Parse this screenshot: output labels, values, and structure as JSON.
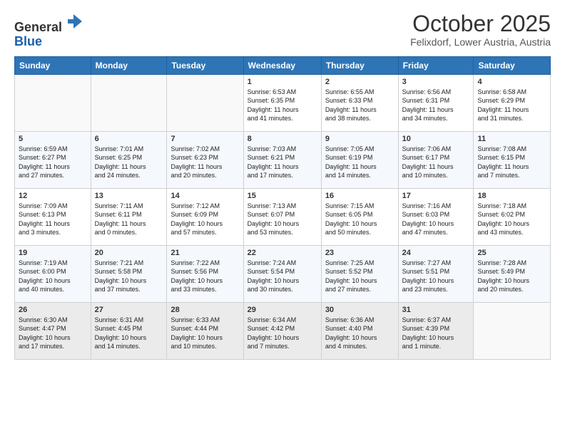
{
  "header": {
    "logo_line1": "General",
    "logo_line2": "Blue",
    "month": "October 2025",
    "location": "Felixdorf, Lower Austria, Austria"
  },
  "weekdays": [
    "Sunday",
    "Monday",
    "Tuesday",
    "Wednesday",
    "Thursday",
    "Friday",
    "Saturday"
  ],
  "weeks": [
    [
      {
        "day": "",
        "info": ""
      },
      {
        "day": "",
        "info": ""
      },
      {
        "day": "",
        "info": ""
      },
      {
        "day": "1",
        "info": "Sunrise: 6:53 AM\nSunset: 6:35 PM\nDaylight: 11 hours\nand 41 minutes."
      },
      {
        "day": "2",
        "info": "Sunrise: 6:55 AM\nSunset: 6:33 PM\nDaylight: 11 hours\nand 38 minutes."
      },
      {
        "day": "3",
        "info": "Sunrise: 6:56 AM\nSunset: 6:31 PM\nDaylight: 11 hours\nand 34 minutes."
      },
      {
        "day": "4",
        "info": "Sunrise: 6:58 AM\nSunset: 6:29 PM\nDaylight: 11 hours\nand 31 minutes."
      }
    ],
    [
      {
        "day": "5",
        "info": "Sunrise: 6:59 AM\nSunset: 6:27 PM\nDaylight: 11 hours\nand 27 minutes."
      },
      {
        "day": "6",
        "info": "Sunrise: 7:01 AM\nSunset: 6:25 PM\nDaylight: 11 hours\nand 24 minutes."
      },
      {
        "day": "7",
        "info": "Sunrise: 7:02 AM\nSunset: 6:23 PM\nDaylight: 11 hours\nand 20 minutes."
      },
      {
        "day": "8",
        "info": "Sunrise: 7:03 AM\nSunset: 6:21 PM\nDaylight: 11 hours\nand 17 minutes."
      },
      {
        "day": "9",
        "info": "Sunrise: 7:05 AM\nSunset: 6:19 PM\nDaylight: 11 hours\nand 14 minutes."
      },
      {
        "day": "10",
        "info": "Sunrise: 7:06 AM\nSunset: 6:17 PM\nDaylight: 11 hours\nand 10 minutes."
      },
      {
        "day": "11",
        "info": "Sunrise: 7:08 AM\nSunset: 6:15 PM\nDaylight: 11 hours\nand 7 minutes."
      }
    ],
    [
      {
        "day": "12",
        "info": "Sunrise: 7:09 AM\nSunset: 6:13 PM\nDaylight: 11 hours\nand 3 minutes."
      },
      {
        "day": "13",
        "info": "Sunrise: 7:11 AM\nSunset: 6:11 PM\nDaylight: 11 hours\nand 0 minutes."
      },
      {
        "day": "14",
        "info": "Sunrise: 7:12 AM\nSunset: 6:09 PM\nDaylight: 10 hours\nand 57 minutes."
      },
      {
        "day": "15",
        "info": "Sunrise: 7:13 AM\nSunset: 6:07 PM\nDaylight: 10 hours\nand 53 minutes."
      },
      {
        "day": "16",
        "info": "Sunrise: 7:15 AM\nSunset: 6:05 PM\nDaylight: 10 hours\nand 50 minutes."
      },
      {
        "day": "17",
        "info": "Sunrise: 7:16 AM\nSunset: 6:03 PM\nDaylight: 10 hours\nand 47 minutes."
      },
      {
        "day": "18",
        "info": "Sunrise: 7:18 AM\nSunset: 6:02 PM\nDaylight: 10 hours\nand 43 minutes."
      }
    ],
    [
      {
        "day": "19",
        "info": "Sunrise: 7:19 AM\nSunset: 6:00 PM\nDaylight: 10 hours\nand 40 minutes."
      },
      {
        "day": "20",
        "info": "Sunrise: 7:21 AM\nSunset: 5:58 PM\nDaylight: 10 hours\nand 37 minutes."
      },
      {
        "day": "21",
        "info": "Sunrise: 7:22 AM\nSunset: 5:56 PM\nDaylight: 10 hours\nand 33 minutes."
      },
      {
        "day": "22",
        "info": "Sunrise: 7:24 AM\nSunset: 5:54 PM\nDaylight: 10 hours\nand 30 minutes."
      },
      {
        "day": "23",
        "info": "Sunrise: 7:25 AM\nSunset: 5:52 PM\nDaylight: 10 hours\nand 27 minutes."
      },
      {
        "day": "24",
        "info": "Sunrise: 7:27 AM\nSunset: 5:51 PM\nDaylight: 10 hours\nand 23 minutes."
      },
      {
        "day": "25",
        "info": "Sunrise: 7:28 AM\nSunset: 5:49 PM\nDaylight: 10 hours\nand 20 minutes."
      }
    ],
    [
      {
        "day": "26",
        "info": "Sunrise: 6:30 AM\nSunset: 4:47 PM\nDaylight: 10 hours\nand 17 minutes."
      },
      {
        "day": "27",
        "info": "Sunrise: 6:31 AM\nSunset: 4:45 PM\nDaylight: 10 hours\nand 14 minutes."
      },
      {
        "day": "28",
        "info": "Sunrise: 6:33 AM\nSunset: 4:44 PM\nDaylight: 10 hours\nand 10 minutes."
      },
      {
        "day": "29",
        "info": "Sunrise: 6:34 AM\nSunset: 4:42 PM\nDaylight: 10 hours\nand 7 minutes."
      },
      {
        "day": "30",
        "info": "Sunrise: 6:36 AM\nSunset: 4:40 PM\nDaylight: 10 hours\nand 4 minutes."
      },
      {
        "day": "31",
        "info": "Sunrise: 6:37 AM\nSunset: 4:39 PM\nDaylight: 10 hours\nand 1 minute."
      },
      {
        "day": "",
        "info": ""
      }
    ]
  ]
}
